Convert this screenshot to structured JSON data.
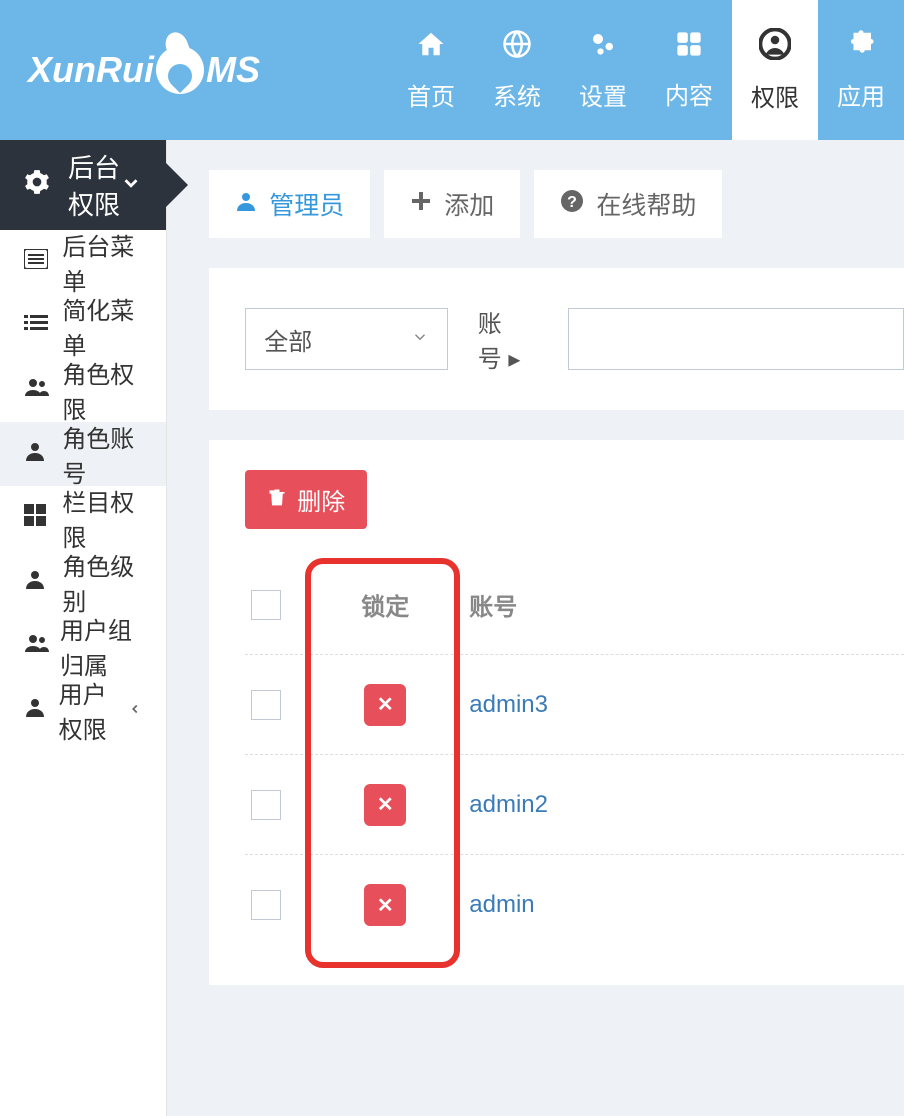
{
  "logo": {
    "pre": "XunRui",
    "post": "MS"
  },
  "nav": [
    {
      "label": "首页",
      "icon": "home"
    },
    {
      "label": "系统",
      "icon": "globe"
    },
    {
      "label": "设置",
      "icon": "cogs"
    },
    {
      "label": "内容",
      "icon": "grid"
    },
    {
      "label": "权限",
      "icon": "user-circle",
      "active": true
    },
    {
      "label": "应用",
      "icon": "puzzle"
    }
  ],
  "sidebar": {
    "head": "后台权限",
    "items": [
      {
        "label": "后台菜单",
        "icon": "list-alt"
      },
      {
        "label": "简化菜单",
        "icon": "list"
      },
      {
        "label": "角色权限",
        "icon": "users"
      },
      {
        "label": "角色账号",
        "icon": "user",
        "active": true
      },
      {
        "label": "栏目权限",
        "icon": "th-large"
      },
      {
        "label": "角色级别",
        "icon": "user"
      },
      {
        "label": "用户组归属",
        "icon": "users"
      },
      {
        "label": "用户权限",
        "icon": "user",
        "expandable": true
      }
    ]
  },
  "tabs": [
    {
      "label": "管理员",
      "icon": "user",
      "active": true
    },
    {
      "label": "添加",
      "icon": "plus"
    },
    {
      "label": "在线帮助",
      "icon": "question"
    }
  ],
  "filter": {
    "select": "全部",
    "label": "账号",
    "arrow": "▸"
  },
  "deleteBtn": "删除",
  "table": {
    "head": {
      "lock": "锁定",
      "account": "账号"
    },
    "rows": [
      {
        "account": "admin3"
      },
      {
        "account": "admin2"
      },
      {
        "account": "admin"
      }
    ]
  }
}
